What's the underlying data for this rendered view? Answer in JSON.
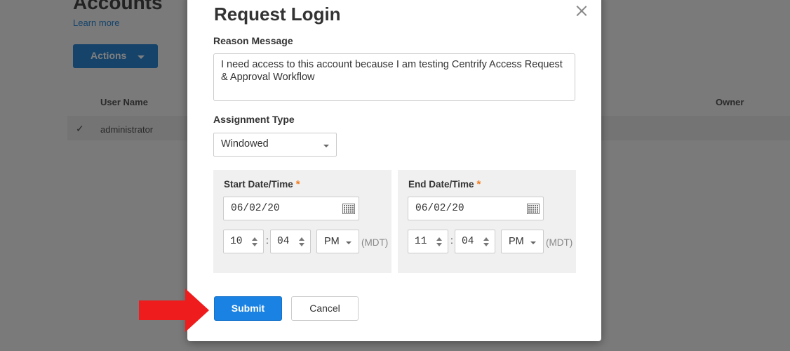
{
  "background": {
    "page_title": "Accounts",
    "learn_more": "Learn more",
    "actions_label": "Actions",
    "column_user_name": "User Name",
    "column_owner": "Owner",
    "row_user": "administrator"
  },
  "modal": {
    "title": "Request Login",
    "reason_label": "Reason Message",
    "reason_value": "I need access to this account because I am testing Centrify Access Request & Approval Workflow",
    "assignment_label": "Assignment Type",
    "assignment_value": "Windowed",
    "start": {
      "label": "Start Date/Time",
      "required": "*",
      "date": "06/02/20",
      "hour": "10",
      "minute": "04",
      "ampm": "PM",
      "timezone": "(MDT)"
    },
    "end": {
      "label": "End Date/Time",
      "required": "*",
      "date": "06/02/20",
      "hour": "11",
      "minute": "04",
      "ampm": "PM",
      "timezone": "(MDT)"
    },
    "submit_label": "Submit",
    "cancel_label": "Cancel"
  },
  "icons": {
    "close": "close-icon",
    "calendar": "calendar-icon",
    "dropdown": "chevron-down-icon",
    "pointer": "red-arrow-icon"
  },
  "colors": {
    "primary": "#1a82e2",
    "required_star": "#f07b1d",
    "annotation_arrow": "#ee1c1c"
  }
}
